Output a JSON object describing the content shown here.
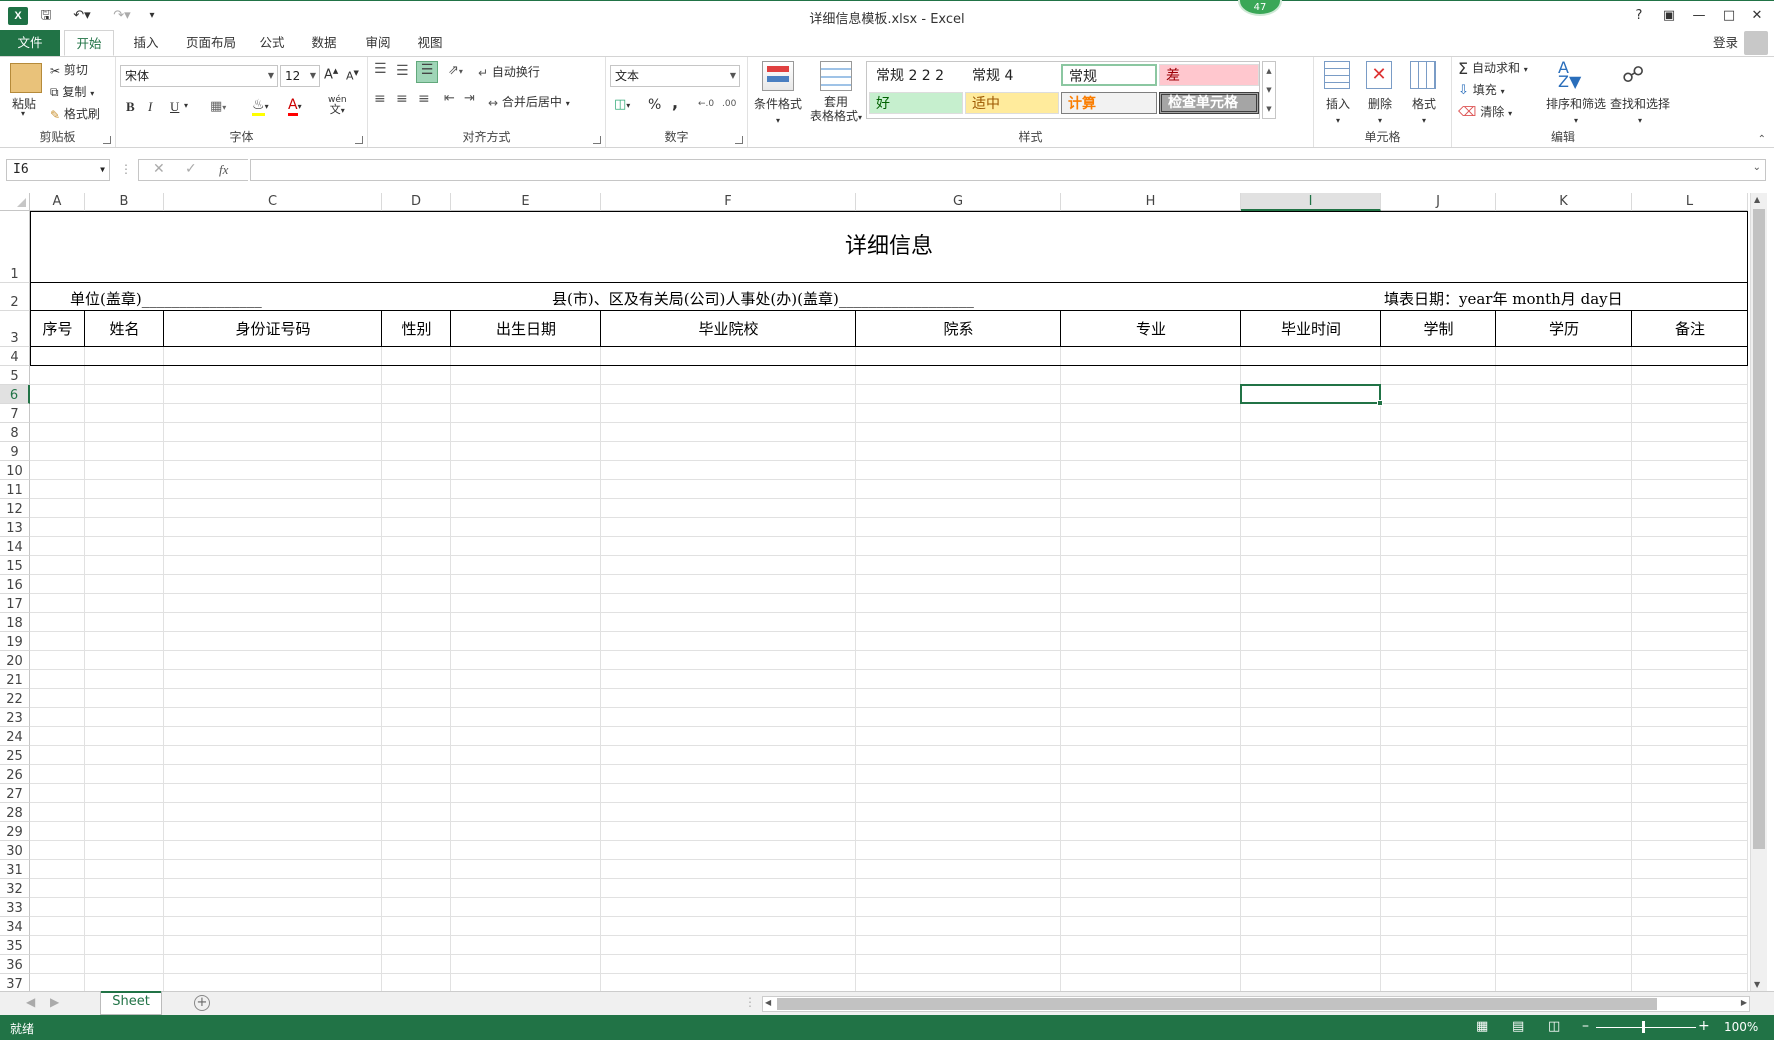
{
  "app": {
    "title": "详细信息模板.xlsx - Excel",
    "badge": "47",
    "login": "登录"
  },
  "tabs": [
    "文件",
    "开始",
    "插入",
    "页面布局",
    "公式",
    "数据",
    "审阅",
    "视图"
  ],
  "ribbon": {
    "clipboard": {
      "name": "剪贴板",
      "paste": "粘贴",
      "cut": "剪切",
      "copy": "复制",
      "format_painter": "格式刷"
    },
    "font": {
      "name": "字体",
      "family": "宋体",
      "size": "12",
      "bold": "B",
      "italic": "I",
      "underline": "U",
      "wen": "wén"
    },
    "alignment": {
      "name": "对齐方式",
      "wrap": "自动换行",
      "merge": "合并后居中"
    },
    "number": {
      "name": "数字",
      "format": "文本",
      "percent": "%",
      "comma": ","
    },
    "styles": {
      "name": "样式",
      "conditional": "条件格式",
      "table_line1": "套用",
      "table_line2": "表格格式",
      "cells": [
        {
          "label": "常规 2 2 2",
          "bg": "#ffffff",
          "fg": "#000000"
        },
        {
          "label": "常规 4",
          "bg": "#ffffff",
          "fg": "#000000"
        },
        {
          "label": "常规",
          "bg": "#ffffff",
          "fg": "#000000"
        },
        {
          "label": "差",
          "bg": "#ffc7ce",
          "fg": "#9c0006"
        },
        {
          "label": "好",
          "bg": "#c6efce",
          "fg": "#006100"
        },
        {
          "label": "适中",
          "bg": "#ffeb9c",
          "fg": "#9c5700"
        },
        {
          "label": "计算",
          "bg": "#f2f2f2",
          "fg": "#fa7d00"
        },
        {
          "label": "检查单元格",
          "bg": "#a5a5a5",
          "fg": "#ffffff"
        }
      ]
    },
    "cells_group": {
      "name": "单元格",
      "insert": "插入",
      "delete": "删除",
      "format": "格式"
    },
    "editing": {
      "name": "编辑",
      "autosum": "自动求和",
      "fill": "填充",
      "clear": "清除",
      "sort": "排序和筛选",
      "find": "查找和选择"
    }
  },
  "formula_bar": {
    "name_box": "I6",
    "content": "",
    "fx": "fx"
  },
  "columns": [
    "A",
    "B",
    "C",
    "D",
    "E",
    "F",
    "G",
    "H",
    "I",
    "J",
    "K",
    "L"
  ],
  "rows": [
    "1",
    "2",
    "3",
    "4",
    "5",
    "6",
    "7",
    "8",
    "9",
    "10",
    "11",
    "12",
    "13",
    "14",
    "15",
    "16",
    "17",
    "18",
    "19",
    "20",
    "21",
    "22",
    "23",
    "24",
    "25",
    "26",
    "27",
    "28",
    "29",
    "30",
    "31",
    "32",
    "33",
    "34",
    "35",
    "36",
    "37"
  ],
  "sheet": {
    "title": "详细信息",
    "row2_left": "单位(盖章)________________",
    "row2_mid": "县(市)、区及有关局(公司)人事处(办)(盖章)__________________",
    "row2_right": "填表日期：year年 month月 day日",
    "headers": [
      "序号",
      "姓名",
      "身份证号码",
      "性别",
      "出生日期",
      "毕业院校",
      "院系",
      "专业",
      "毕业时间",
      "学制",
      "学历",
      "备注"
    ]
  },
  "sheet_tab": "Sheet",
  "status": {
    "ready": "就绪",
    "zoom": "100%"
  }
}
